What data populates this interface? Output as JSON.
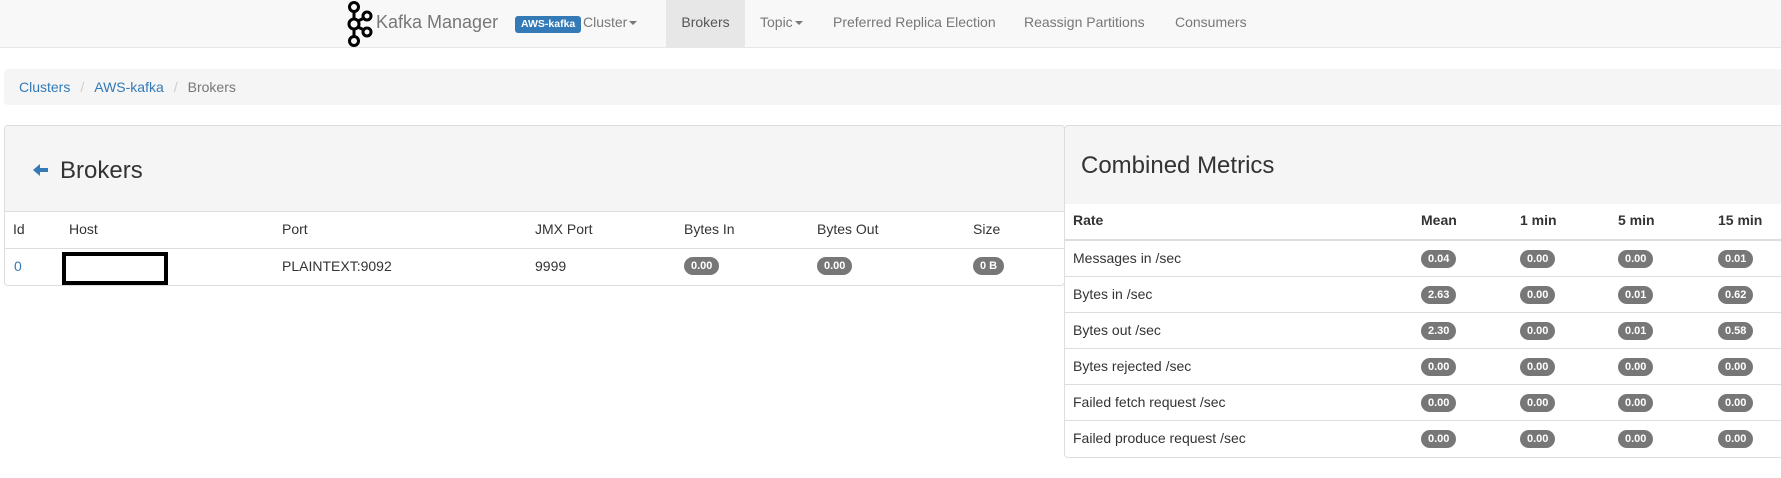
{
  "navbar": {
    "brand": "Kafka Manager",
    "cluster_badge": "AWS-kafka",
    "items": [
      {
        "label": "Cluster",
        "dropdown": true
      },
      {
        "label": "Brokers",
        "active": true
      },
      {
        "label": "Topic",
        "dropdown": true
      },
      {
        "label": "Preferred Replica Election"
      },
      {
        "label": "Reassign Partitions"
      },
      {
        "label": "Consumers"
      }
    ]
  },
  "breadcrumb": [
    "Clusters",
    "AWS-kafka",
    "Brokers"
  ],
  "brokers": {
    "title": "Brokers",
    "columns": [
      "Id",
      "Host",
      "Port",
      "JMX Port",
      "Bytes In",
      "Bytes Out",
      "Size"
    ],
    "rows": [
      {
        "id": "0",
        "host": "",
        "port": "PLAINTEXT:9092",
        "jmx_port": "9999",
        "bytes_in": "0.00",
        "bytes_out": "0.00",
        "size": "0 B"
      }
    ]
  },
  "metrics": {
    "title": "Combined Metrics",
    "columns": [
      "Rate",
      "Mean",
      "1 min",
      "5 min",
      "15 min"
    ],
    "rows": [
      {
        "rate": "Messages in /sec",
        "mean": "0.04",
        "m1": "0.00",
        "m5": "0.00",
        "m15": "0.01"
      },
      {
        "rate": "Bytes in /sec",
        "mean": "2.63",
        "m1": "0.00",
        "m5": "0.01",
        "m15": "0.62"
      },
      {
        "rate": "Bytes out /sec",
        "mean": "2.30",
        "m1": "0.00",
        "m5": "0.01",
        "m15": "0.58"
      },
      {
        "rate": "Bytes rejected /sec",
        "mean": "0.00",
        "m1": "0.00",
        "m5": "0.00",
        "m15": "0.00"
      },
      {
        "rate": "Failed fetch request /sec",
        "mean": "0.00",
        "m1": "0.00",
        "m5": "0.00",
        "m15": "0.00"
      },
      {
        "rate": "Failed produce request /sec",
        "mean": "0.00",
        "m1": "0.00",
        "m5": "0.00",
        "m15": "0.00"
      }
    ]
  },
  "colors": {
    "link": "#337ab7",
    "badge": "#777777",
    "navbar_bg": "#f8f8f8",
    "panel_heading_bg": "#f5f5f5"
  }
}
